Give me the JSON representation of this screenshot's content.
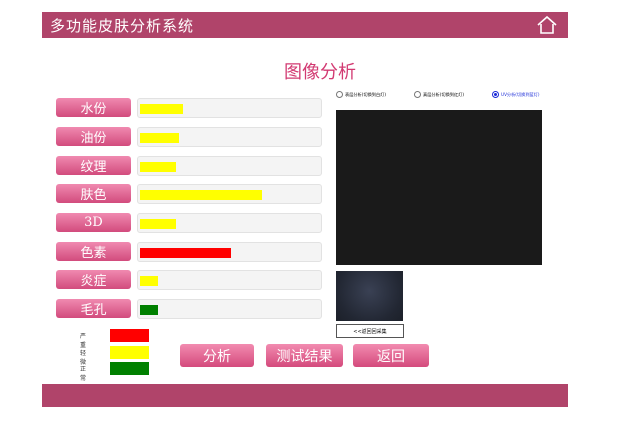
{
  "header": {
    "title": "多功能皮肤分析系统",
    "home_icon": "home-icon"
  },
  "page": {
    "title": "图像分析"
  },
  "metrics": [
    {
      "label": "水份",
      "level": 0.24,
      "color": "#ffff00"
    },
    {
      "label": "油份",
      "level": 0.22,
      "color": "#ffff00"
    },
    {
      "label": "纹理",
      "level": 0.2,
      "color": "#ffff00"
    },
    {
      "label": "肤色",
      "level": 0.68,
      "color": "#ffff00"
    },
    {
      "label": "3D",
      "level": 0.2,
      "color": "#ffff00"
    },
    {
      "label": "色素",
      "level": 0.51,
      "color": "#ff0000"
    },
    {
      "label": "炎症",
      "level": 0.1,
      "color": "#ffff00"
    },
    {
      "label": "毛孔",
      "level": 0.1,
      "color": "#008000"
    }
  ],
  "modes": [
    {
      "label": "表层分析(切换到白灯)",
      "selected": false
    },
    {
      "label": "真层分析(切换到红灯)",
      "selected": false
    },
    {
      "label": "UV分析(切换到蓝灯)",
      "selected": true
    }
  ],
  "capture_button": "<<返回回采集",
  "legend": [
    {
      "label": "严重",
      "color": "#ff0000"
    },
    {
      "label": "轻微",
      "color": "#ffff00"
    },
    {
      "label": "正常",
      "color": "#008000"
    }
  ],
  "actions": {
    "analyze": "分析",
    "results": "测试结果",
    "back": "返回"
  },
  "colors": {
    "brand": "#b0446a",
    "button": "#d24b7d",
    "title": "#d23a72"
  }
}
